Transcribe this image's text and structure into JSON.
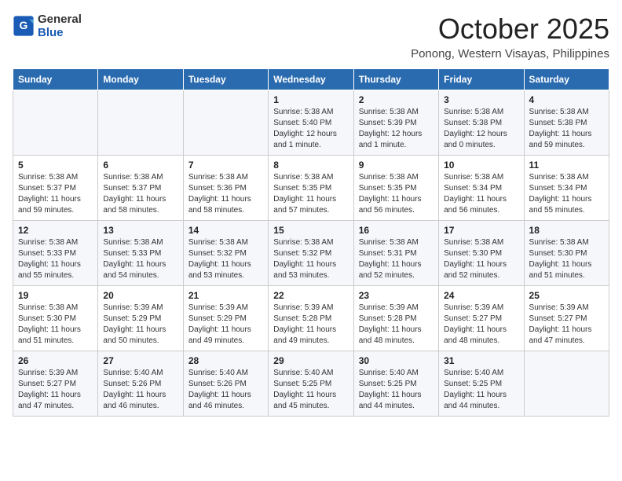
{
  "header": {
    "logo_general": "General",
    "logo_blue": "Blue",
    "month_year": "October 2025",
    "location": "Ponong, Western Visayas, Philippines"
  },
  "weekdays": [
    "Sunday",
    "Monday",
    "Tuesday",
    "Wednesday",
    "Thursday",
    "Friday",
    "Saturday"
  ],
  "weeks": [
    [
      {
        "day": "",
        "detail": ""
      },
      {
        "day": "",
        "detail": ""
      },
      {
        "day": "",
        "detail": ""
      },
      {
        "day": "1",
        "detail": "Sunrise: 5:38 AM\nSunset: 5:40 PM\nDaylight: 12 hours\nand 1 minute."
      },
      {
        "day": "2",
        "detail": "Sunrise: 5:38 AM\nSunset: 5:39 PM\nDaylight: 12 hours\nand 1 minute."
      },
      {
        "day": "3",
        "detail": "Sunrise: 5:38 AM\nSunset: 5:38 PM\nDaylight: 12 hours\nand 0 minutes."
      },
      {
        "day": "4",
        "detail": "Sunrise: 5:38 AM\nSunset: 5:38 PM\nDaylight: 11 hours\nand 59 minutes."
      }
    ],
    [
      {
        "day": "5",
        "detail": "Sunrise: 5:38 AM\nSunset: 5:37 PM\nDaylight: 11 hours\nand 59 minutes."
      },
      {
        "day": "6",
        "detail": "Sunrise: 5:38 AM\nSunset: 5:37 PM\nDaylight: 11 hours\nand 58 minutes."
      },
      {
        "day": "7",
        "detail": "Sunrise: 5:38 AM\nSunset: 5:36 PM\nDaylight: 11 hours\nand 58 minutes."
      },
      {
        "day": "8",
        "detail": "Sunrise: 5:38 AM\nSunset: 5:35 PM\nDaylight: 11 hours\nand 57 minutes."
      },
      {
        "day": "9",
        "detail": "Sunrise: 5:38 AM\nSunset: 5:35 PM\nDaylight: 11 hours\nand 56 minutes."
      },
      {
        "day": "10",
        "detail": "Sunrise: 5:38 AM\nSunset: 5:34 PM\nDaylight: 11 hours\nand 56 minutes."
      },
      {
        "day": "11",
        "detail": "Sunrise: 5:38 AM\nSunset: 5:34 PM\nDaylight: 11 hours\nand 55 minutes."
      }
    ],
    [
      {
        "day": "12",
        "detail": "Sunrise: 5:38 AM\nSunset: 5:33 PM\nDaylight: 11 hours\nand 55 minutes."
      },
      {
        "day": "13",
        "detail": "Sunrise: 5:38 AM\nSunset: 5:33 PM\nDaylight: 11 hours\nand 54 minutes."
      },
      {
        "day": "14",
        "detail": "Sunrise: 5:38 AM\nSunset: 5:32 PM\nDaylight: 11 hours\nand 53 minutes."
      },
      {
        "day": "15",
        "detail": "Sunrise: 5:38 AM\nSunset: 5:32 PM\nDaylight: 11 hours\nand 53 minutes."
      },
      {
        "day": "16",
        "detail": "Sunrise: 5:38 AM\nSunset: 5:31 PM\nDaylight: 11 hours\nand 52 minutes."
      },
      {
        "day": "17",
        "detail": "Sunrise: 5:38 AM\nSunset: 5:30 PM\nDaylight: 11 hours\nand 52 minutes."
      },
      {
        "day": "18",
        "detail": "Sunrise: 5:38 AM\nSunset: 5:30 PM\nDaylight: 11 hours\nand 51 minutes."
      }
    ],
    [
      {
        "day": "19",
        "detail": "Sunrise: 5:38 AM\nSunset: 5:30 PM\nDaylight: 11 hours\nand 51 minutes."
      },
      {
        "day": "20",
        "detail": "Sunrise: 5:39 AM\nSunset: 5:29 PM\nDaylight: 11 hours\nand 50 minutes."
      },
      {
        "day": "21",
        "detail": "Sunrise: 5:39 AM\nSunset: 5:29 PM\nDaylight: 11 hours\nand 49 minutes."
      },
      {
        "day": "22",
        "detail": "Sunrise: 5:39 AM\nSunset: 5:28 PM\nDaylight: 11 hours\nand 49 minutes."
      },
      {
        "day": "23",
        "detail": "Sunrise: 5:39 AM\nSunset: 5:28 PM\nDaylight: 11 hours\nand 48 minutes."
      },
      {
        "day": "24",
        "detail": "Sunrise: 5:39 AM\nSunset: 5:27 PM\nDaylight: 11 hours\nand 48 minutes."
      },
      {
        "day": "25",
        "detail": "Sunrise: 5:39 AM\nSunset: 5:27 PM\nDaylight: 11 hours\nand 47 minutes."
      }
    ],
    [
      {
        "day": "26",
        "detail": "Sunrise: 5:39 AM\nSunset: 5:27 PM\nDaylight: 11 hours\nand 47 minutes."
      },
      {
        "day": "27",
        "detail": "Sunrise: 5:40 AM\nSunset: 5:26 PM\nDaylight: 11 hours\nand 46 minutes."
      },
      {
        "day": "28",
        "detail": "Sunrise: 5:40 AM\nSunset: 5:26 PM\nDaylight: 11 hours\nand 46 minutes."
      },
      {
        "day": "29",
        "detail": "Sunrise: 5:40 AM\nSunset: 5:25 PM\nDaylight: 11 hours\nand 45 minutes."
      },
      {
        "day": "30",
        "detail": "Sunrise: 5:40 AM\nSunset: 5:25 PM\nDaylight: 11 hours\nand 44 minutes."
      },
      {
        "day": "31",
        "detail": "Sunrise: 5:40 AM\nSunset: 5:25 PM\nDaylight: 11 hours\nand 44 minutes."
      },
      {
        "day": "",
        "detail": ""
      }
    ]
  ]
}
